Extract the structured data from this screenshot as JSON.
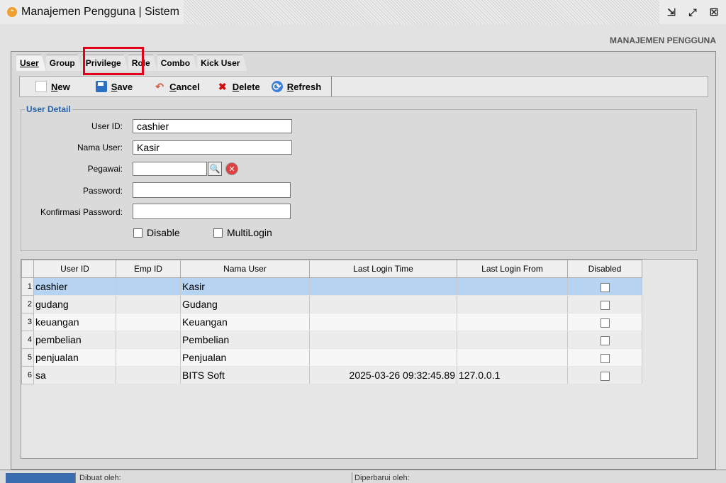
{
  "window": {
    "title": "Manajemen Pengguna | Sistem",
    "controls": [
      "⇲",
      "⤢",
      "☒"
    ]
  },
  "header_label": "MANAJEMEN PENGGUNA",
  "tabs": [
    {
      "label": "User",
      "active": true
    },
    {
      "label": "Group",
      "active": false
    },
    {
      "label": "Privilege",
      "active": false
    },
    {
      "label": "Role",
      "active": false
    },
    {
      "label": "Combo",
      "active": false
    },
    {
      "label": "Kick User",
      "active": false
    }
  ],
  "toolbar": {
    "new_label": "New",
    "save_label": "Save",
    "cancel_label": "Cancel",
    "delete_label": "Delete",
    "refresh_label": "Refresh"
  },
  "user_detail": {
    "legend": "User Detail",
    "user_id_label": "User ID:",
    "user_id_value": "cashier",
    "nama_user_label": "Nama User:",
    "nama_user_value": "Kasir",
    "pegawai_label": "Pegawai:",
    "pegawai_value": "",
    "password_label": "Password:",
    "password_value": "",
    "konfirmasi_label": "Konfirmasi Password:",
    "konfirmasi_value": "",
    "disable_label": "Disable",
    "multilogin_label": "MultiLogin"
  },
  "grid": {
    "columns": [
      "User ID",
      "Emp ID",
      "Nama User",
      "Last Login Time",
      "Last Login From",
      "Disabled"
    ],
    "rows": [
      {
        "n": "1",
        "user_id": "cashier",
        "emp_id": "",
        "nama": "Kasir",
        "time": "",
        "from": "",
        "disabled": false
      },
      {
        "n": "2",
        "user_id": "gudang",
        "emp_id": "",
        "nama": "Gudang",
        "time": "",
        "from": "",
        "disabled": false
      },
      {
        "n": "3",
        "user_id": "keuangan",
        "emp_id": "",
        "nama": "Keuangan",
        "time": "",
        "from": "",
        "disabled": false
      },
      {
        "n": "4",
        "user_id": "pembelian",
        "emp_id": "",
        "nama": "Pembelian",
        "time": "",
        "from": "",
        "disabled": false
      },
      {
        "n": "5",
        "user_id": "penjualan",
        "emp_id": "",
        "nama": "Penjualan",
        "time": "",
        "from": "",
        "disabled": false
      },
      {
        "n": "6",
        "user_id": "sa",
        "emp_id": "",
        "nama": "BITS Soft",
        "time": "2025-03-26 09:32:45.89",
        "from": "127.0.0.1",
        "disabled": false
      }
    ]
  },
  "status": {
    "created_by_label": "Dibuat oleh:",
    "updated_by_label": "Diperbarui oleh:"
  },
  "colors": {
    "selected_row": "#b6d3f1",
    "highlight_box": "#e0001a",
    "legend_text": "#2a62a8"
  }
}
